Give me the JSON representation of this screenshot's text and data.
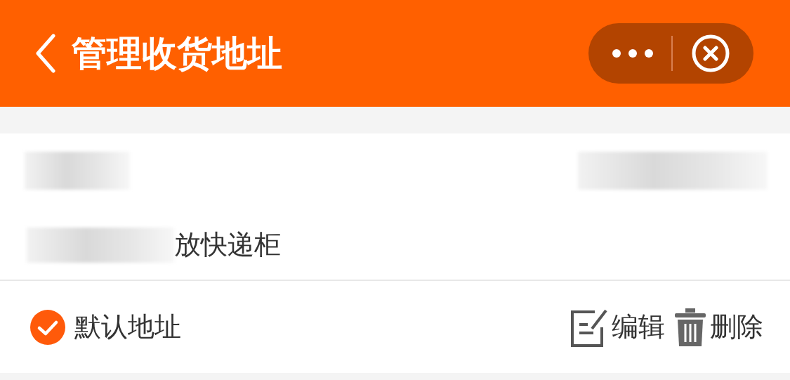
{
  "header": {
    "title": "管理收货地址"
  },
  "address": {
    "detail": "放快递柜",
    "is_default": true,
    "default_label": "默认地址",
    "actions": [
      {
        "kind": "edit",
        "label": "编辑"
      },
      {
        "kind": "delete",
        "label": "删除"
      }
    ]
  }
}
